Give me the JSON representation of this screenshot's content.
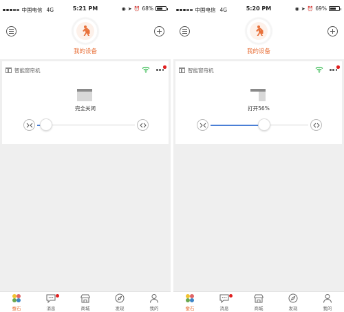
{
  "screens": [
    {
      "status": {
        "carrier": "中国电信",
        "network": "4G",
        "time": "5:21 PM",
        "battery": "68%",
        "battery_level": 0.68
      },
      "header": {
        "title": "我的设备"
      },
      "device": {
        "name": "智能窗帘机",
        "state_text": "完全关闭",
        "open_fraction": 0.0
      },
      "tabs": [
        {
          "label": "蚕石",
          "icon": "gem-cluster-icon",
          "active": true
        },
        {
          "label": "消息",
          "icon": "chat-icon",
          "badge": true
        },
        {
          "label": "商城",
          "icon": "store-icon"
        },
        {
          "label": "发现",
          "icon": "compass-icon"
        },
        {
          "label": "我的",
          "icon": "person-icon"
        }
      ]
    },
    {
      "status": {
        "carrier": "中国电信",
        "network": "4G",
        "time": "5:20 PM",
        "battery": "69%",
        "battery_level": 0.69
      },
      "header": {
        "title": "我的设备"
      },
      "device": {
        "name": "智能窗帘机",
        "state_text": "打开56%",
        "open_fraction": 0.56
      },
      "tabs": [
        {
          "label": "蚕石",
          "icon": "gem-cluster-icon",
          "active": true
        },
        {
          "label": "消息",
          "icon": "chat-icon",
          "badge": true
        },
        {
          "label": "商城",
          "icon": "store-icon"
        },
        {
          "label": "发现",
          "icon": "compass-icon"
        },
        {
          "label": "我的",
          "icon": "person-icon"
        }
      ]
    }
  ],
  "colors": {
    "accent": "#e8713a",
    "slider_fill": "#4a7fd6",
    "wifi": "#2fb84a",
    "badge": "#e02020"
  }
}
